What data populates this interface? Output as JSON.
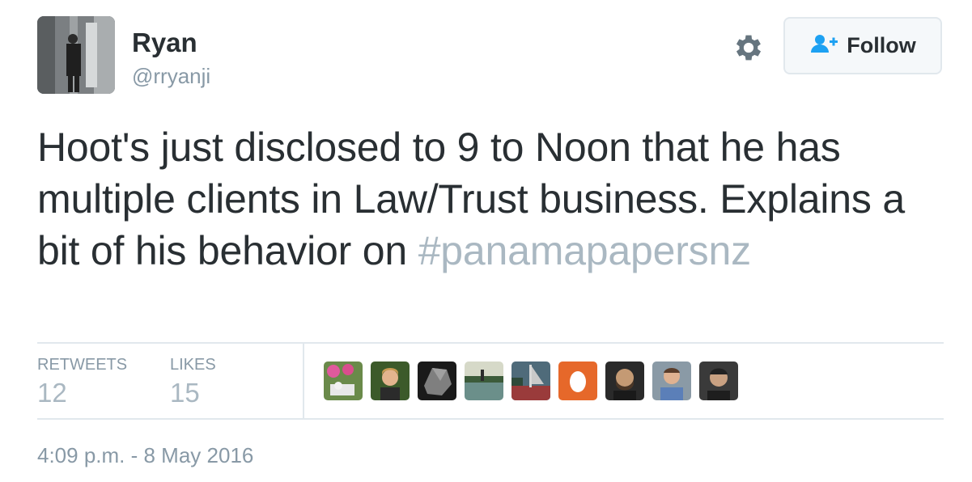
{
  "user": {
    "name": "Ryan",
    "handle": "@rryanji"
  },
  "follow_button": {
    "label": "Follow"
  },
  "tweet": {
    "text": "Hoot's just disclosed to 9 to Noon that he has multiple clients in Law/Trust business. Explains a bit of his behavior on ",
    "hashtag": "#panamapapersnz"
  },
  "stats": {
    "retweets_label": "RETWEETS",
    "retweets_value": "12",
    "likes_label": "LIKES",
    "likes_value": "15"
  },
  "likers": [
    {
      "icon": "liker-avatar-flowers"
    },
    {
      "icon": "liker-avatar-woman"
    },
    {
      "icon": "liker-avatar-rock"
    },
    {
      "icon": "liker-avatar-landscape"
    },
    {
      "icon": "liker-avatar-boat"
    },
    {
      "icon": "liker-avatar-egg"
    },
    {
      "icon": "liker-avatar-man-beard"
    },
    {
      "icon": "liker-avatar-man-shirt"
    },
    {
      "icon": "liker-avatar-man-dark"
    }
  ],
  "timestamp": "4:09 p.m. - 8 May 2016",
  "colors": {
    "text": "#292f33",
    "muted": "#8899a6",
    "hashtag": "#aab8c2",
    "follow_icon": "#1da1f2",
    "divider": "#e1e8ed"
  }
}
